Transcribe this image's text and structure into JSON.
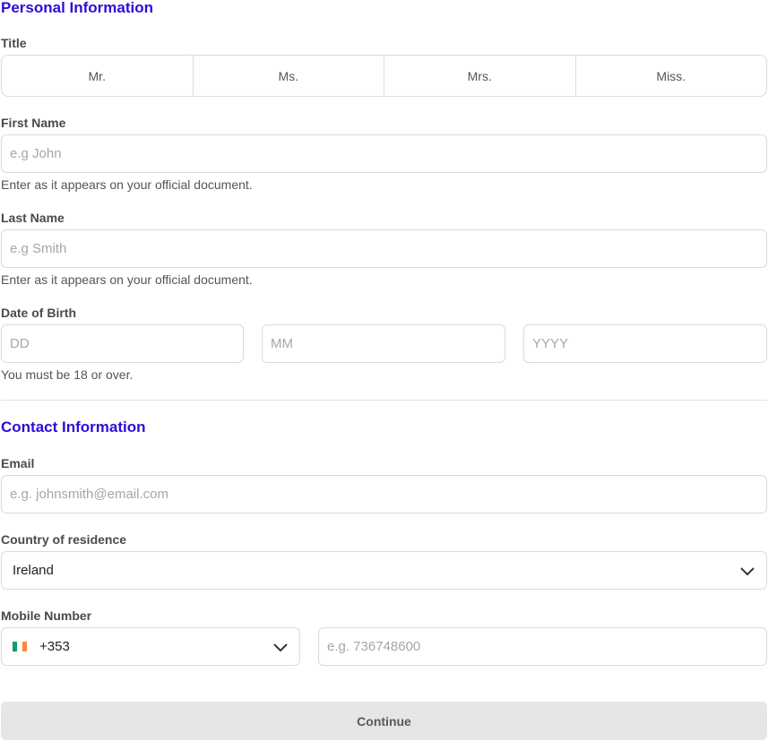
{
  "personal": {
    "heading": "Personal Information",
    "title_label": "Title",
    "title_options": [
      "Mr.",
      "Ms.",
      "Mrs.",
      "Miss."
    ],
    "first_name": {
      "label": "First Name",
      "placeholder": "e.g John",
      "value": "",
      "helper": "Enter as it appears on your official document."
    },
    "last_name": {
      "label": "Last Name",
      "placeholder": "e.g Smith",
      "value": "",
      "helper": "Enter as it appears on your official document."
    },
    "dob": {
      "label": "Date of Birth",
      "day_placeholder": "DD",
      "month_placeholder": "MM",
      "year_placeholder": "YYYY",
      "helper": "You must be 18 or over."
    }
  },
  "contact": {
    "heading": "Contact Information",
    "email": {
      "label": "Email",
      "placeholder": "e.g. johnsmith@email.com",
      "value": ""
    },
    "country": {
      "label": "Country of residence",
      "selected": "Ireland",
      "icon": "chevron-down-icon"
    },
    "mobile": {
      "label": "Mobile Number",
      "dial_code": "+353",
      "flag_icon": "ireland-flag-icon",
      "flag_colors": [
        "#169b62",
        "#ffffff",
        "#ff883e"
      ],
      "number_placeholder": "e.g. 736748600",
      "value": ""
    }
  },
  "actions": {
    "continue_label": "Continue"
  },
  "colors": {
    "heading": "#2a0fd6",
    "button_bg": "#e6e6e6",
    "border": "#dcdcdc"
  }
}
